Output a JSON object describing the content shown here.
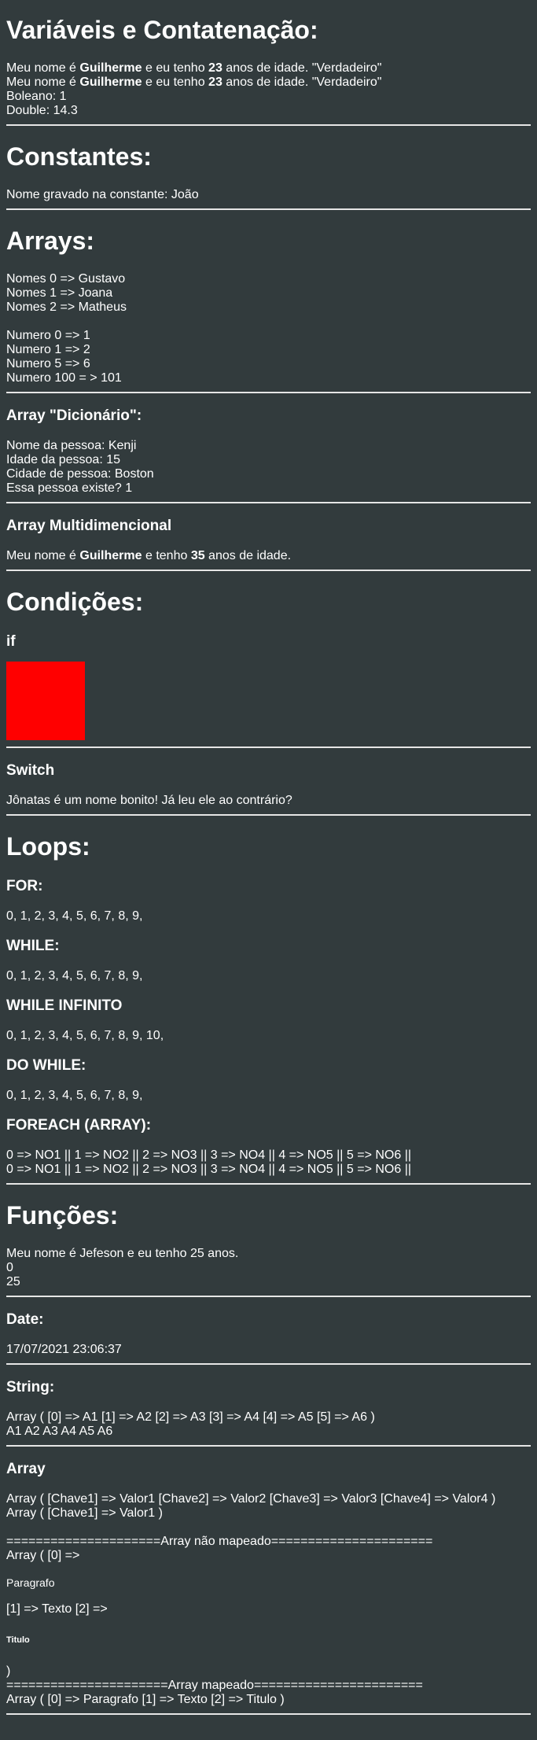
{
  "colors": {
    "background": "#323b3d",
    "text": "#ffffff",
    "divider": "#e6e6e6",
    "if_box": "#ff0000"
  },
  "vars": {
    "title": "Variáveis e Contatenação:",
    "l1_pre": "Meu nome é ",
    "l1_name": "Guilherme",
    "l1_mid": " e eu tenho ",
    "l1_age": "23",
    "l1_post": " anos de idade. \"Verdadeiro\"",
    "l2_pre": "Meu nome é ",
    "l2_name": "Guilherme",
    "l2_mid": " e eu tenho ",
    "l2_age": "23",
    "l2_post": " anos de idade. \"Verdadeiro\"",
    "bool": "Boleano: 1",
    "double": "Double: 14.3"
  },
  "constants": {
    "title": "Constantes:",
    "line": "Nome gravado na constante: João"
  },
  "arrays": {
    "title": "Arrays:",
    "names": [
      "Nomes 0 => Gustavo",
      "Nomes 1 => Joana",
      "Nomes 2 => Matheus"
    ],
    "numbers": [
      "Numero 0 => 1",
      "Numero 1 => 2",
      "Numero 5 => 6",
      "Numero 100 = > 101"
    ]
  },
  "dict": {
    "title": "Array \"Dicionário\":",
    "lines": [
      "Nome da pessoa: Kenji",
      "Idade da pessoa: 15",
      "Cidade de pessoa: Boston",
      "Essa pessoa existe? 1"
    ]
  },
  "multi": {
    "title": "Array Multidimencional",
    "pre": "Meu nome é ",
    "name": "Guilherme",
    "mid": " e tenho ",
    "age": "35",
    "post": " anos de idade."
  },
  "conditions": {
    "title": "Condições:",
    "if_title": "if",
    "switch_title": "Switch",
    "switch_line": "Jônatas é um nome bonito! Já leu ele ao contrário?"
  },
  "loops": {
    "title": "Loops:",
    "for_title": "FOR:",
    "for_line": "0, 1, 2, 3, 4, 5, 6, 7, 8, 9,",
    "while_title": "WHILE:",
    "while_line": "0, 1, 2, 3, 4, 5, 6, 7, 8, 9,",
    "winf_title": "WHILE INFINITO",
    "winf_line": "0, 1, 2, 3, 4, 5, 6, 7, 8, 9, 10,",
    "dowhile_title": "DO WHILE:",
    "dowhile_line": "0, 1, 2, 3, 4, 5, 6, 7, 8, 9,",
    "foreach_title": "FOREACH (ARRAY):",
    "foreach_lines": [
      "0 => NO1 || 1 => NO2 || 2 => NO3 || 3 => NO4 || 4 => NO5 || 5 => NO6 ||",
      "0 => NO1 || 1 => NO2 || 2 => NO3 || 3 => NO4 || 4 => NO5 || 5 => NO6 ||"
    ]
  },
  "functions": {
    "title": "Funções:",
    "lines": [
      "Meu nome é Jefeson e eu tenho 25 anos.",
      "0",
      "25"
    ]
  },
  "date": {
    "title": "Date:",
    "line": "17/07/2021 23:06:37"
  },
  "string": {
    "title": "String:",
    "lines": [
      "Array ( [0] => A1 [1] => A2 [2] => A3 [3] => A4 [4] => A5 [5] => A6 )",
      "A1 A2 A3 A4 A5 A6"
    ]
  },
  "array2": {
    "title": "Array",
    "lines": [
      "Array ( [Chave1] => Valor1 [Chave2] => Valor2 [Chave3] => Valor3 [Chave4] => Valor4 )",
      "Array ( [Chave1] => Valor1 )"
    ],
    "unmapped_sep": "=====================Array não mapeado======================",
    "unmapped_open": "Array ( [0] =>",
    "paragrafo": "Paragrafo",
    "texto_line": "[1] => Texto [2] =>",
    "titulo": "Titulo",
    "close": ")",
    "mapped_sep": "======================Array mapeado=======================",
    "mapped_line": "Array ( [0] => Paragrafo [1] => Texto [2] => Titulo )"
  }
}
